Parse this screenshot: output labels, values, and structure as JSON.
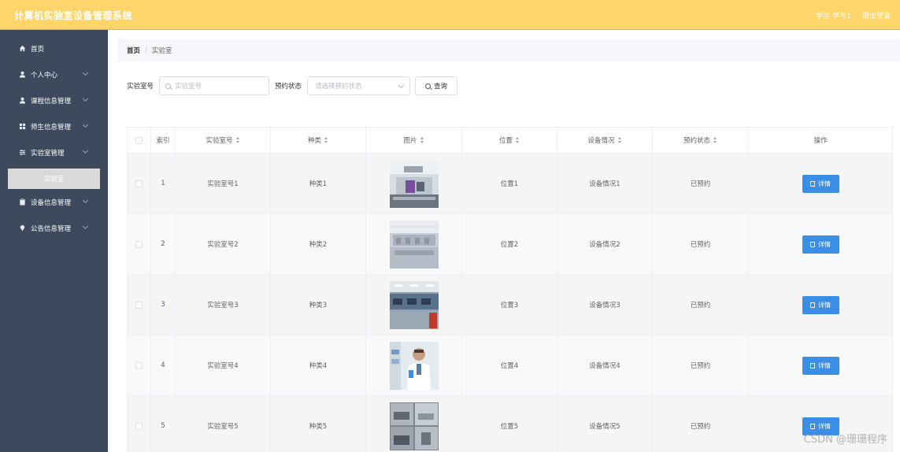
{
  "app": {
    "title": "计算机实验室设备管理系统"
  },
  "topbar": {
    "user": "学生 学号1",
    "logout": "退出登录"
  },
  "sidebar": {
    "items": [
      {
        "label": "首页",
        "icon": "home-icon",
        "has_children": false
      },
      {
        "label": "个人中心",
        "icon": "user-icon",
        "has_children": true
      },
      {
        "label": "课程信息管理",
        "icon": "user-icon",
        "has_children": true
      },
      {
        "label": "师生信息管理",
        "icon": "grid-icon",
        "has_children": true
      },
      {
        "label": "实验室管理",
        "icon": "sliders-icon",
        "has_children": true
      },
      {
        "label": "设备信息管理",
        "icon": "clipboard-icon",
        "has_children": true
      },
      {
        "label": "公告信息管理",
        "icon": "pin-icon",
        "has_children": true
      }
    ],
    "active_sub": "实验室"
  },
  "breadcrumb": {
    "home": "首页",
    "sep": "/",
    "current": "实验室"
  },
  "search": {
    "lab_label": "实验室号",
    "lab_placeholder": "实验室号",
    "status_label": "预约状态",
    "status_placeholder": "请选择预约状态",
    "query_button": "查询"
  },
  "table": {
    "headers": [
      "索引",
      "实验室号",
      "种类",
      "图片",
      "位置",
      "设备情况",
      "预约状态",
      "操作"
    ],
    "rows": [
      {
        "index": "1",
        "lab": "实验室号1",
        "kind": "种类1",
        "location": "位置1",
        "equipment": "设备情况1",
        "status": "已预约",
        "action": "详情"
      },
      {
        "index": "2",
        "lab": "实验室号2",
        "kind": "种类2",
        "location": "位置2",
        "equipment": "设备情况2",
        "status": "已预约",
        "action": "详情"
      },
      {
        "index": "3",
        "lab": "实验室号3",
        "kind": "种类3",
        "location": "位置3",
        "equipment": "设备情况3",
        "status": "已预约",
        "action": "详情"
      },
      {
        "index": "4",
        "lab": "实验室号4",
        "kind": "种类4",
        "location": "位置4",
        "equipment": "设备情况4",
        "status": "已预约",
        "action": "详情"
      },
      {
        "index": "5",
        "lab": "实验室号5",
        "kind": "种类5",
        "location": "位置5",
        "equipment": "设备情况5",
        "status": "已预约",
        "action": "详情"
      }
    ]
  },
  "watermark": "CSDN @珊珊程序",
  "colors": {
    "topbar": "#fdd56b",
    "sidebar": "#3d4a5e",
    "primary": "#3a8ee6"
  }
}
